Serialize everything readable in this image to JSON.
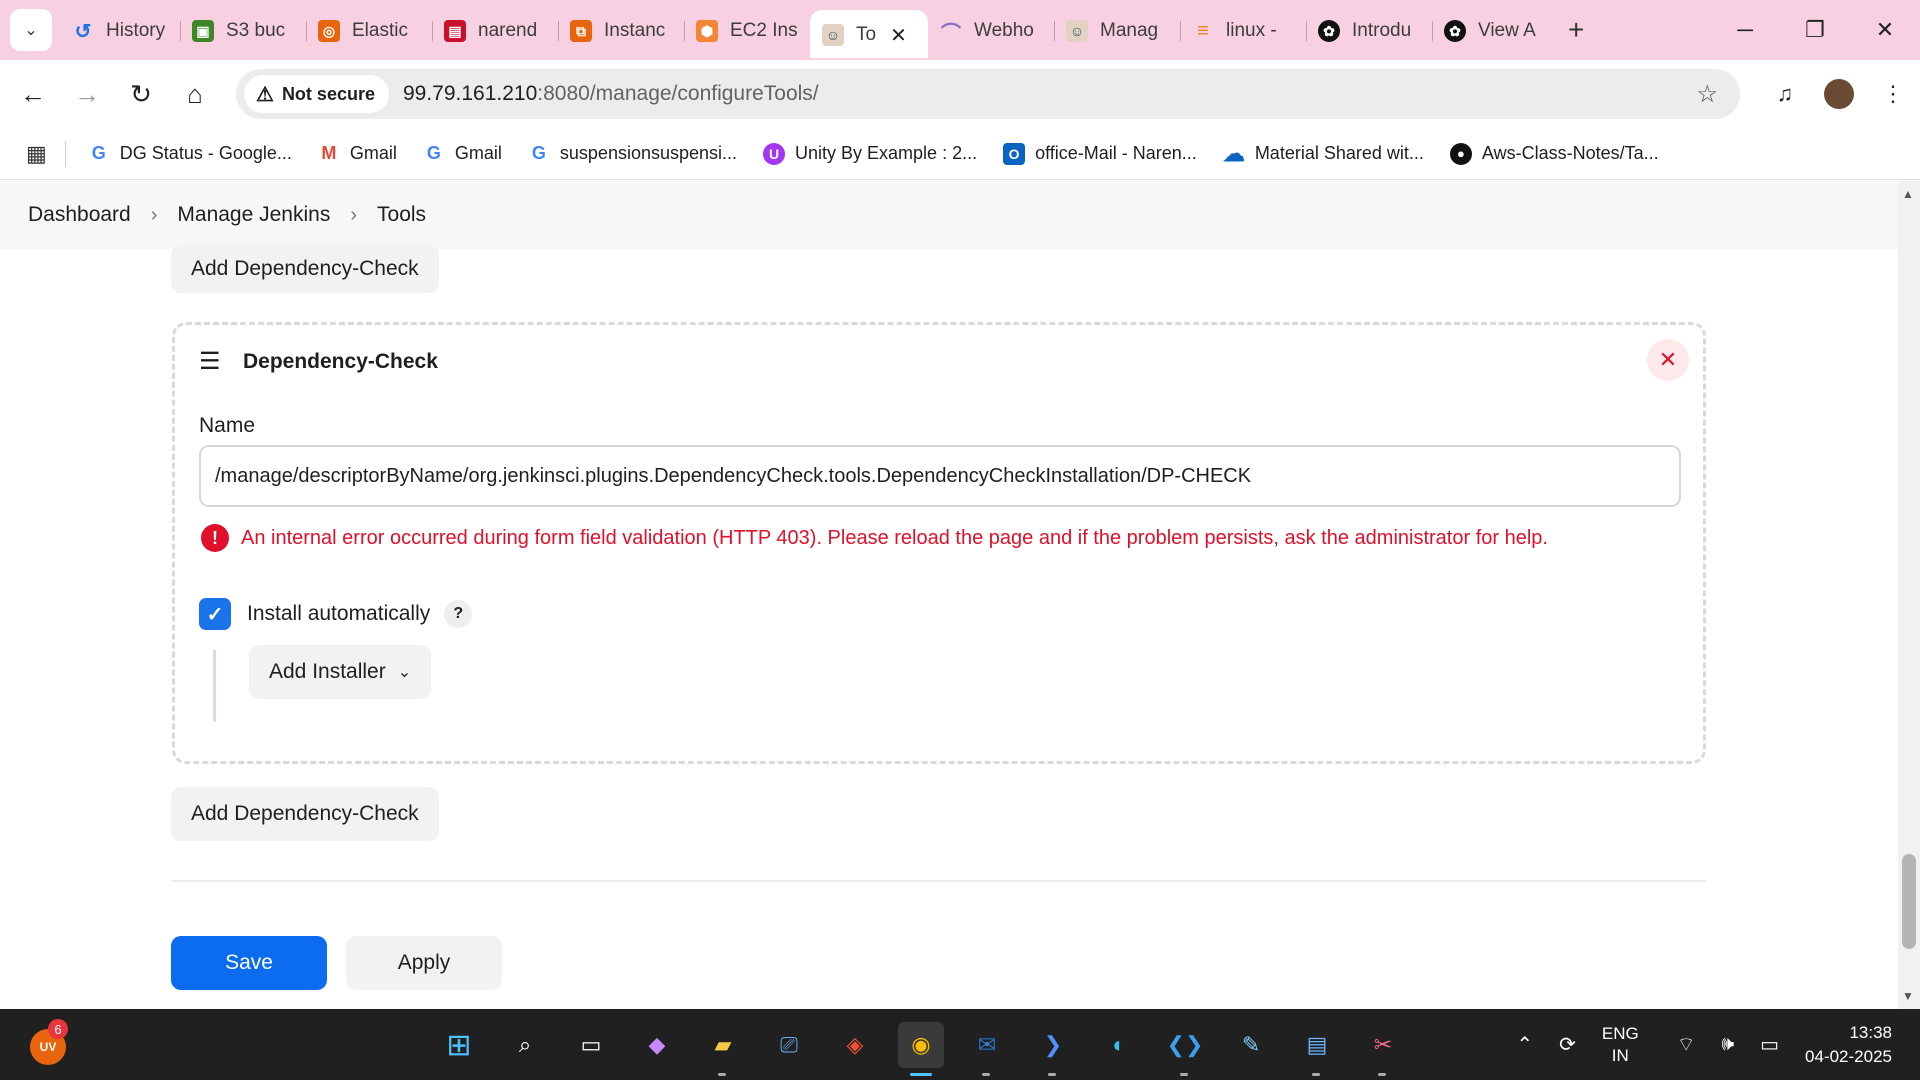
{
  "browser": {
    "tabs": [
      {
        "title": "History",
        "icon": "history-icon",
        "color": "#1a73e8"
      },
      {
        "title": "S3 buc",
        "icon": "s3-icon",
        "color": "#3f8624"
      },
      {
        "title": "Elastic",
        "icon": "aws-elastic-icon",
        "color": "#e8650e"
      },
      {
        "title": "narend",
        "icon": "doc-icon",
        "color": "#c8102e"
      },
      {
        "title": "Instanc",
        "icon": "aws-instance-icon",
        "color": "#e8650e"
      },
      {
        "title": "EC2 Ins",
        "icon": "ec2-icon",
        "color": "#f58536"
      },
      {
        "title": "To",
        "icon": "jenkins-icon",
        "color": "#335061",
        "active": true
      },
      {
        "title": "Webho",
        "icon": "webhook-icon",
        "color": "#8a6fc7"
      },
      {
        "title": "Manag",
        "icon": "jenkins-icon",
        "color": "#335061"
      },
      {
        "title": "linux -",
        "icon": "stackoverflow-icon",
        "color": "#f48024"
      },
      {
        "title": "Introdu",
        "icon": "openai-icon",
        "color": "#111111"
      },
      {
        "title": "View A",
        "icon": "openai-icon",
        "color": "#111111"
      }
    ],
    "security_label": "Not secure",
    "url_host": "99.79.161.210",
    "url_path": ":8080/manage/configureTools/",
    "bookmarks": [
      {
        "label": "DG Status - Google...",
        "icon": "google-icon"
      },
      {
        "label": "Gmail",
        "icon": "gmail-icon"
      },
      {
        "label": "Gmail",
        "icon": "google-icon"
      },
      {
        "label": "suspensionsuspensi...",
        "icon": "google-icon"
      },
      {
        "label": "Unity By Example : 2...",
        "icon": "udemy-icon"
      },
      {
        "label": "office-Mail - Naren...",
        "icon": "outlook-icon"
      },
      {
        "label": "Material Shared wit...",
        "icon": "onedrive-icon"
      },
      {
        "label": "Aws-Class-Notes/Ta...",
        "icon": "github-icon"
      }
    ]
  },
  "breadcrumb": [
    "Dashboard",
    "Manage Jenkins",
    "Tools"
  ],
  "page": {
    "add_top_label": "Add Dependency-Check",
    "card": {
      "title": "Dependency-Check",
      "name_label": "Name",
      "name_value": "/manage/descriptorByName/org.jenkinsci.plugins.DependencyCheck.tools.DependencyCheckInstallation/DP-CHECK",
      "error_text": "An internal error occurred during form field validation (HTTP 403). Please reload the page and if the problem persists, ask the administrator for help.",
      "install_label": "Install automatically",
      "install_checked": true,
      "help_label": "?",
      "add_installer_label": "Add Installer"
    },
    "add_bottom_label": "Add Dependency-Check",
    "save_label": "Save",
    "apply_label": "Apply"
  },
  "taskbar": {
    "weather_label": "UV",
    "notification_count": "6",
    "lang_top": "ENG",
    "lang_bottom": "IN",
    "time": "13:38",
    "date": "04-02-2025"
  },
  "colors": {
    "accent": "#0b6cf0",
    "error": "#e0102a",
    "tab_strip": "#f7d0e2"
  }
}
